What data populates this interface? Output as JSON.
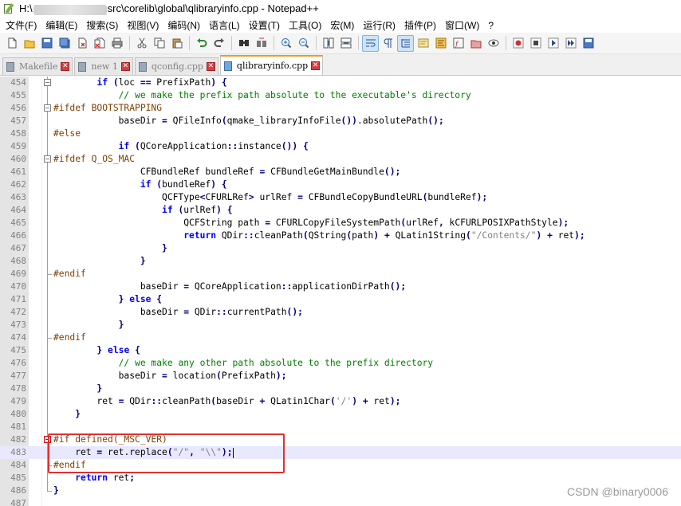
{
  "window": {
    "title_prefix": "H:\\",
    "title_suffix": "src\\corelib\\global\\qlibraryinfo.cpp - Notepad++"
  },
  "menu": [
    "文件(F)",
    "编辑(E)",
    "搜索(S)",
    "视图(V)",
    "编码(N)",
    "语言(L)",
    "设置(T)",
    "工具(O)",
    "宏(M)",
    "运行(R)",
    "插件(P)",
    "窗口(W)",
    "?"
  ],
  "toolbar": {
    "icons": [
      "new-file-icon",
      "open-file-icon",
      "save-icon",
      "save-all-icon",
      "close-icon",
      "close-all-icon",
      "print-icon",
      "cut-icon",
      "copy-icon",
      "paste-icon",
      "undo-icon",
      "redo-icon",
      "find-icon",
      "replace-icon",
      "zoom-in-icon",
      "zoom-out-icon",
      "sync-vertical-icon",
      "sync-horizontal-icon",
      "word-wrap-icon",
      "show-all-chars-icon",
      "indent-guide-icon",
      "user-lang-icon",
      "doc-map-icon",
      "function-list-icon",
      "folder-workspace-icon",
      "monitoring-icon",
      "record-macro-icon",
      "stop-record-icon",
      "play-macro-icon",
      "run-macro-multiple-icon",
      "save-macro-icon"
    ]
  },
  "tabs": [
    {
      "label": "Makefile",
      "active": false
    },
    {
      "label": "new 1",
      "active": false
    },
    {
      "label": "qconfig.cpp",
      "active": false
    },
    {
      "label": "qlibraryinfo.cpp",
      "active": true
    }
  ],
  "editor": {
    "lines": [
      {
        "num": "454",
        "code": "        if (loc == PrefixPath) {"
      },
      {
        "num": "455",
        "code": "            // we make the prefix path absolute to the executable's directory"
      },
      {
        "num": "456",
        "code": "#ifdef BOOTSTRAPPING"
      },
      {
        "num": "457",
        "code": "            baseDir = QFileInfo(qmake_libraryInfoFile()).absolutePath();"
      },
      {
        "num": "458",
        "code": "#else"
      },
      {
        "num": "459",
        "code": "            if (QCoreApplication::instance()) {"
      },
      {
        "num": "460",
        "code": "#ifdef Q_OS_MAC"
      },
      {
        "num": "461",
        "code": "                CFBundleRef bundleRef = CFBundleGetMainBundle();"
      },
      {
        "num": "462",
        "code": "                if (bundleRef) {"
      },
      {
        "num": "463",
        "code": "                    QCFType<CFURLRef> urlRef = CFBundleCopyBundleURL(bundleRef);"
      },
      {
        "num": "464",
        "code": "                    if (urlRef) {"
      },
      {
        "num": "465",
        "code": "                        QCFString path = CFURLCopyFileSystemPath(urlRef, kCFURLPOSIXPathStyle);"
      },
      {
        "num": "466",
        "code": "                        return QDir::cleanPath(QString(path) + QLatin1String(\"/Contents/\") + ret);"
      },
      {
        "num": "467",
        "code": "                    }"
      },
      {
        "num": "468",
        "code": "                }"
      },
      {
        "num": "469",
        "code": "#endif"
      },
      {
        "num": "470",
        "code": "                baseDir = QCoreApplication::applicationDirPath();"
      },
      {
        "num": "471",
        "code": "            } else {"
      },
      {
        "num": "472",
        "code": "                baseDir = QDir::currentPath();"
      },
      {
        "num": "473",
        "code": "            }"
      },
      {
        "num": "474",
        "code": "#endif"
      },
      {
        "num": "475",
        "code": "        } else {"
      },
      {
        "num": "476",
        "code": "            // we make any other path absolute to the prefix directory"
      },
      {
        "num": "477",
        "code": "            baseDir = location(PrefixPath);"
      },
      {
        "num": "478",
        "code": "        }"
      },
      {
        "num": "479",
        "code": "        ret = QDir::cleanPath(baseDir + QLatin1Char('/') + ret);"
      },
      {
        "num": "480",
        "code": "    }"
      },
      {
        "num": "481",
        "code": ""
      },
      {
        "num": "482",
        "code": "#if defined(_MSC_VER)"
      },
      {
        "num": "483",
        "code": "    ret = ret.replace(\"/\", \"\\\\\");"
      },
      {
        "num": "484",
        "code": "#endif"
      },
      {
        "num": "485",
        "code": "    return ret;"
      },
      {
        "num": "486",
        "code": "}"
      },
      {
        "num": "487",
        "code": ""
      }
    ]
  },
  "watermark": "CSDN @binary0006"
}
